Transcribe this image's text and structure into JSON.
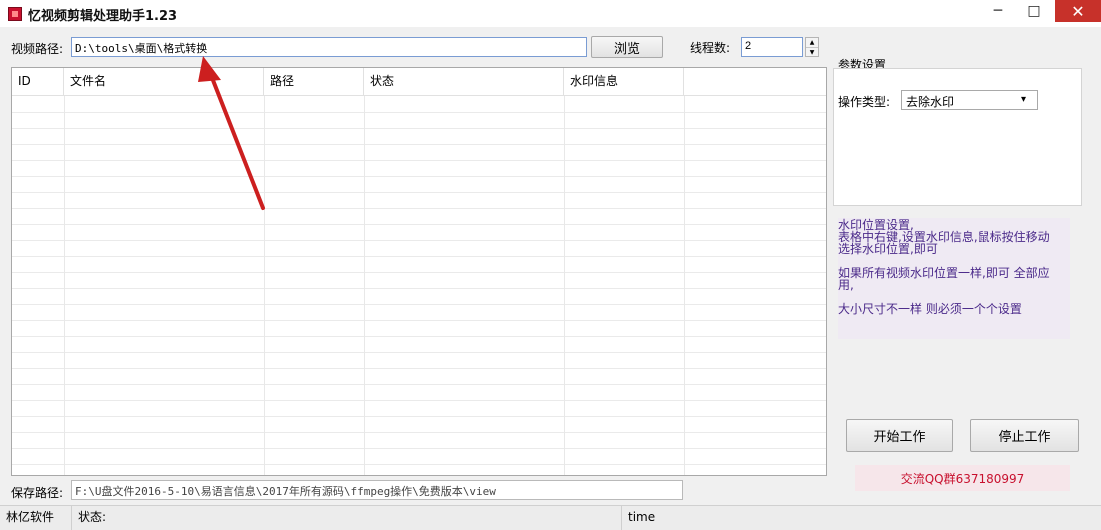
{
  "window": {
    "title": "忆视频剪辑处理助手1.23",
    "minimize": "─",
    "maximize": "□",
    "close": "✕"
  },
  "video_path": {
    "label": "视频路径:",
    "value": "D:\\tools\\桌面\\格式转换",
    "browse_label": "浏览"
  },
  "threads": {
    "label": "线程数:",
    "value": "2",
    "up": "▲",
    "down": "▼"
  },
  "table": {
    "columns": [
      "ID",
      "文件名",
      "路径",
      "状态",
      "水印信息"
    ]
  },
  "params": {
    "group_label": "参数设置",
    "op_label": "操作类型:",
    "op_value": "去除水印"
  },
  "note": {
    "line1": "水印位置设置,",
    "line2": "表格中右键,设置水印信息,鼠标按住移动",
    "line3": "选择水印位置,即可",
    "line4": "如果所有视频水印位置一样,即可 全部应",
    "line5": "用,",
    "line6": "大小尺寸不一样 则必须一个个设置"
  },
  "actions": {
    "start_label": "开始工作",
    "stop_label": "停止工作"
  },
  "qq": "交流QQ群637180997",
  "save_path": {
    "label": "保存路径:",
    "value": "F:\\U盘文件2016-5-10\\易语言信息\\2017年所有源码\\ffmpeg操作\\免费版本\\view"
  },
  "status": {
    "author": "林亿软件",
    "status_label": "状态:",
    "time_label": "time"
  },
  "colors": {
    "arrow": "#cc1f1f",
    "note_text": "#4b2a8a",
    "qq_text": "#c8102e",
    "close_btn": "#c7312a"
  }
}
